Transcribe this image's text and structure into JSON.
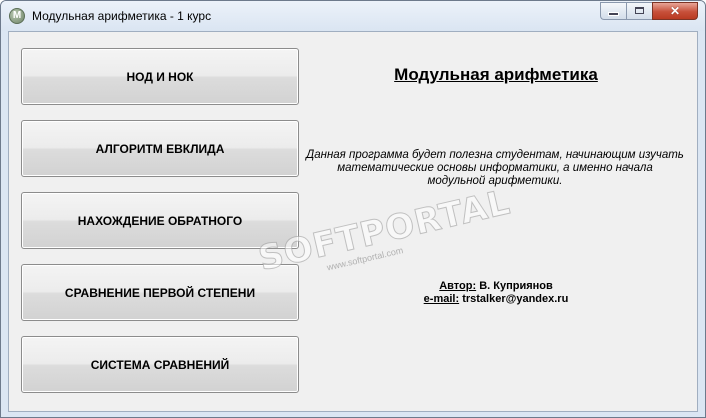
{
  "window": {
    "title": "Модульная арифметика - 1 курс",
    "icon_letter": "M",
    "controls": {
      "minimize": "minimize-icon",
      "maximize": "maximize-icon",
      "close": "close-icon",
      "close_glyph": "✕"
    }
  },
  "menu_buttons": [
    {
      "label": "НОД И НОК"
    },
    {
      "label": "АЛГОРИТМ ЕВКЛИДА"
    },
    {
      "label": "НАХОЖДЕНИЕ ОБРАТНОГО"
    },
    {
      "label": "СРАВНЕНИЕ ПЕРВОЙ СТЕПЕНИ"
    },
    {
      "label": "СИСТЕМА СРАВНЕНИЙ"
    }
  ],
  "info": {
    "heading": "Модульная арифметика",
    "description_lines": [
      "Данная программа будет полезна студентам, начинающим изучать",
      "математические основы информатики, а именно начала",
      "модульной арифметики."
    ],
    "author_label": "Автор:",
    "author_value": " В. Куприянов",
    "email_label": "e-mail:",
    "email_value": " trstalker@yandex.ru"
  },
  "watermark": {
    "text": "SOFTPORTAL",
    "url": "www.softportal.com"
  },
  "colors": {
    "client_bg": "#f0f0f0",
    "titlebar_bg": "#dae5f2",
    "close_red": "#c7503a"
  }
}
